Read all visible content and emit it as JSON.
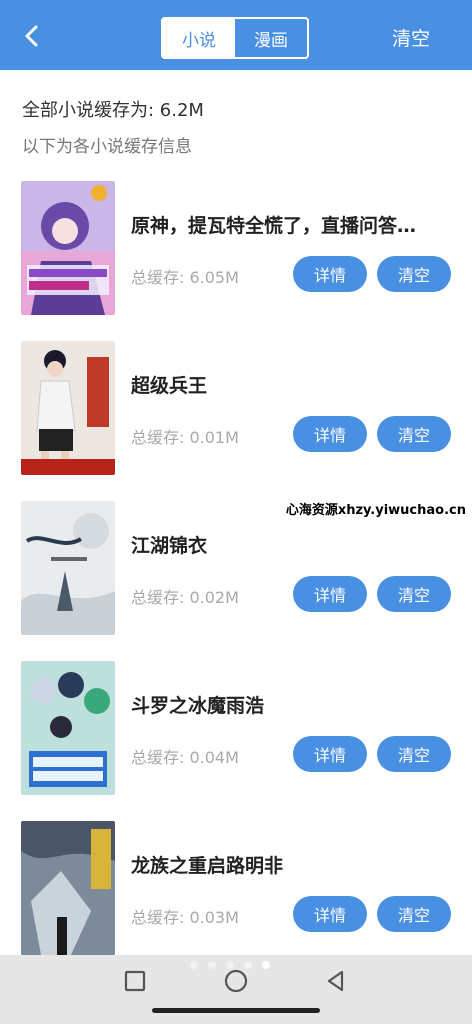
{
  "header": {
    "back_icon": "chevron-left-icon",
    "tabs": [
      {
        "label": "小说",
        "active": true
      },
      {
        "label": "漫画",
        "active": false
      }
    ],
    "clear_label": "清空",
    "accent_color": "#4a90e2"
  },
  "summary": "全部小说缓存为: 6.2M",
  "subinfo": "以下为各小说缓存信息",
  "items": [
    {
      "title": "原神，提瓦特全慌了，直播问答聊...",
      "size": "总缓存: 6.05M",
      "detail_label": "详情",
      "clear_label": "清空"
    },
    {
      "title": "超级兵王",
      "size": "总缓存: 0.01M",
      "detail_label": "详情",
      "clear_label": "清空"
    },
    {
      "title": "江湖锦衣",
      "size": "总缓存: 0.02M",
      "detail_label": "详情",
      "clear_label": "清空"
    },
    {
      "title": "斗罗之冰魔雨浩",
      "size": "总缓存: 0.04M",
      "detail_label": "详情",
      "clear_label": "清空"
    },
    {
      "title": "龙族之重启路明非",
      "size": "总缓存: 0.03M",
      "detail_label": "详情",
      "clear_label": "清空"
    }
  ],
  "watermark": "心海资源xhzy.yiwuchao.cn",
  "navbar": {
    "icons": [
      "recent-apps-icon",
      "home-icon",
      "back-triangle-icon"
    ]
  }
}
